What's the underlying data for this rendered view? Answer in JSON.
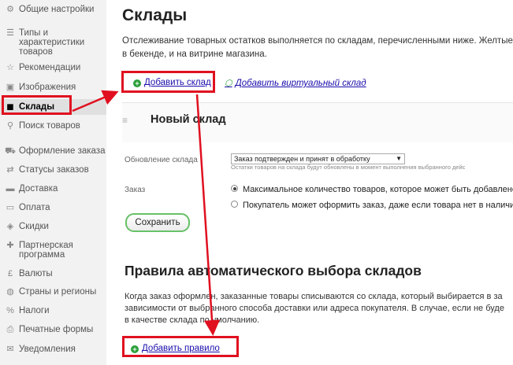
{
  "sidebar": {
    "items": [
      {
        "label": "Общие настройки",
        "icon": "sliders-icon",
        "glyph": "⚙"
      },
      {
        "label": "Типы и характеристики товаров",
        "icon": "list-icon",
        "glyph": "☰"
      },
      {
        "label": "Рекомендации",
        "icon": "star-icon",
        "glyph": "☆"
      },
      {
        "label": "Изображения",
        "icon": "image-icon",
        "glyph": "▣"
      },
      {
        "label": "Склады",
        "icon": "cube-icon",
        "glyph": "◼"
      },
      {
        "label": "Поиск товаров",
        "icon": "search-icon",
        "glyph": "⚲"
      },
      {
        "label": "Оформление заказа",
        "icon": "cart-icon",
        "glyph": "⛟"
      },
      {
        "label": "Статусы заказов",
        "icon": "flow-icon",
        "glyph": "⇄"
      },
      {
        "label": "Доставка",
        "icon": "truck-icon",
        "glyph": "▬"
      },
      {
        "label": "Оплата",
        "icon": "card-icon",
        "glyph": "▭"
      },
      {
        "label": "Скидки",
        "icon": "discount-icon",
        "glyph": "◈"
      },
      {
        "label": "Партнерская программа",
        "icon": "partner-icon",
        "glyph": "✚"
      },
      {
        "label": "Валюты",
        "icon": "pound-icon",
        "glyph": "£"
      },
      {
        "label": "Страны и регионы",
        "icon": "globe-icon",
        "glyph": "◍"
      },
      {
        "label": "Налоги",
        "icon": "percent-icon",
        "glyph": "%"
      },
      {
        "label": "Печатные формы",
        "icon": "printer-icon",
        "glyph": "⎙"
      },
      {
        "label": "Уведомления",
        "icon": "mail-icon",
        "glyph": "✉"
      }
    ]
  },
  "main": {
    "title": "Склады",
    "description_line1": "Отслеживание товарных остатков выполняется по складам, перечисленными ниже. Желтые и",
    "description_line2": "в бекенде, и на витрине магазина.",
    "add_warehouse_label": "Добавить склад",
    "add_virtual_label": "Добавить виртуальный склад",
    "panel_title": "Новый склад",
    "update_label": "Обновление склада",
    "update_select_value": "Заказ подтвержден и принят в обработку",
    "update_hint": "Остатки товаров на склада будут обновлены в момент выполнения выбранного дейс",
    "order_label": "Заказ",
    "radio_option1": "Максимальное количество товаров, которое может быть добавлено в",
    "radio_option2": "Покупатель может оформить заказ, даже если товара нет в наличии т",
    "save_label": "Сохранить",
    "rules_title": "Правила автоматического выбора складов",
    "rules_desc_line1": "Когда заказ оформлен, заказанные товары списываются со склада, который выбирается в за",
    "rules_desc_line2": "зависимости от выбранного способа доставки или адреса покупателя. В случае, если не буде",
    "rules_desc_line3": "в качестве склада по умолчанию.",
    "add_rule_label": "Добавить правило"
  },
  "colors": {
    "annotation_red": "#e01020",
    "accent_green": "#2c9f3a",
    "link_blue": "#1a0dab"
  }
}
